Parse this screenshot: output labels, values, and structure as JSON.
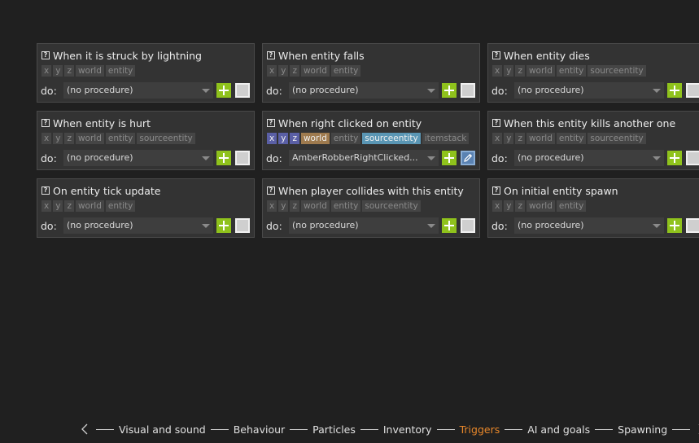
{
  "triggers": [
    {
      "title": "When it is struck by lightning",
      "deps": [
        "x",
        "y",
        "z",
        "world",
        "entity"
      ],
      "active_deps": [],
      "do_label": "do:",
      "procedure": "(no procedure)",
      "bound": false
    },
    {
      "title": "When entity falls",
      "deps": [
        "x",
        "y",
        "z",
        "world",
        "entity"
      ],
      "active_deps": [],
      "do_label": "do:",
      "procedure": "(no procedure)",
      "bound": false
    },
    {
      "title": "When entity dies",
      "deps": [
        "x",
        "y",
        "z",
        "world",
        "entity",
        "sourceentity"
      ],
      "active_deps": [],
      "do_label": "do:",
      "procedure": "(no procedure)",
      "bound": false
    },
    {
      "title": "When entity is hurt",
      "deps": [
        "x",
        "y",
        "z",
        "world",
        "entity",
        "sourceentity"
      ],
      "active_deps": [],
      "do_label": "do:",
      "procedure": "(no procedure)",
      "bound": false
    },
    {
      "title": "When right clicked on entity",
      "deps": [
        "x",
        "y",
        "z",
        "world",
        "entity",
        "sourceentity",
        "itemstack"
      ],
      "active_deps": [
        "x",
        "y",
        "z",
        "world",
        "sourceentity"
      ],
      "do_label": "do:",
      "procedure": "AmberRobberRightClicked...",
      "bound": true
    },
    {
      "title": "When this entity kills another one",
      "deps": [
        "x",
        "y",
        "z",
        "world",
        "entity",
        "sourceentity"
      ],
      "active_deps": [],
      "do_label": "do:",
      "procedure": "(no procedure)",
      "bound": false
    },
    {
      "title": "On entity tick update",
      "deps": [
        "x",
        "y",
        "z",
        "world",
        "entity"
      ],
      "active_deps": [],
      "do_label": "do:",
      "procedure": "(no procedure)",
      "bound": false
    },
    {
      "title": "When player collides with this entity",
      "deps": [
        "x",
        "y",
        "z",
        "world",
        "entity",
        "sourceentity"
      ],
      "active_deps": [],
      "do_label": "do:",
      "procedure": "(no procedure)",
      "bound": false
    },
    {
      "title": "On initial entity spawn",
      "deps": [
        "x",
        "y",
        "z",
        "world",
        "entity"
      ],
      "active_deps": [],
      "do_label": "do:",
      "procedure": "(no procedure)",
      "bound": false
    }
  ],
  "dep_colors": {
    "x": "#5a5fa5",
    "y": "#5a5fa5",
    "z": "#5a5fa5",
    "world": "#9e7a4e",
    "entity": "#606060",
    "sourceentity": "#5a96b4",
    "itemstack": "#606060"
  },
  "bottom_nav": {
    "items": [
      "Visual and sound",
      "Behaviour",
      "Particles",
      "Inventory",
      "Triggers",
      "AI and goals",
      "Spawning"
    ],
    "active": "Triggers",
    "active_color": "#e8872a"
  }
}
